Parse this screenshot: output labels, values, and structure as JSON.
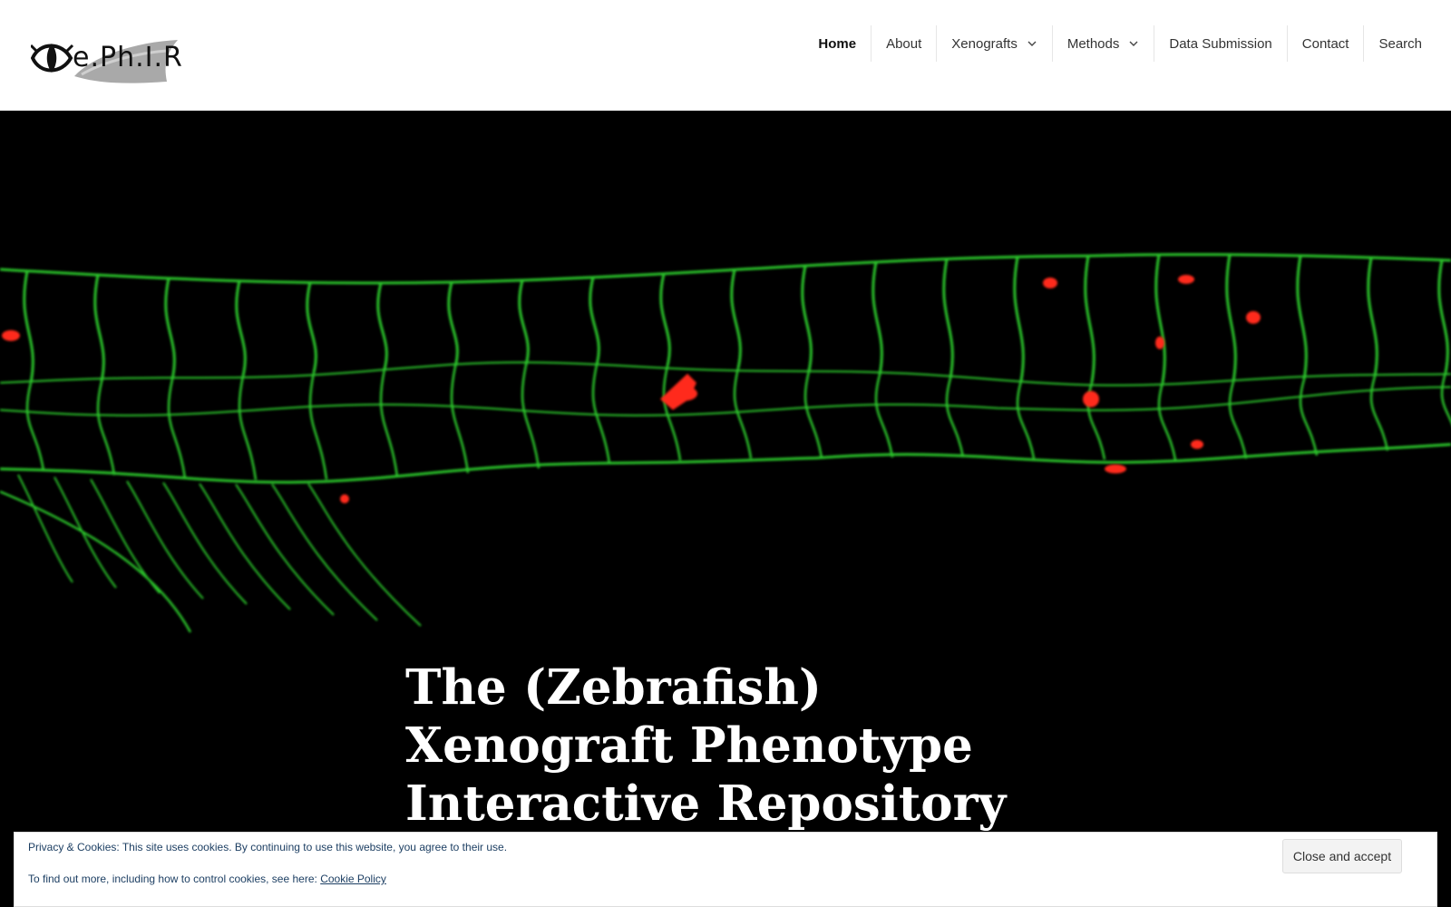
{
  "site": {
    "logo_text": "e.Ph.I.R",
    "logo_icon": "eye-fish-icon"
  },
  "nav": {
    "items": [
      {
        "label": "Home",
        "active": true,
        "has_submenu": false
      },
      {
        "label": "About",
        "active": false,
        "has_submenu": false
      },
      {
        "label": "Xenografts",
        "active": false,
        "has_submenu": true
      },
      {
        "label": "Methods",
        "active": false,
        "has_submenu": true
      },
      {
        "label": "Data Submission",
        "active": false,
        "has_submenu": false
      },
      {
        "label": "Contact",
        "active": false,
        "has_submenu": false
      },
      {
        "label": "Search",
        "active": false,
        "has_submenu": false
      }
    ]
  },
  "hero": {
    "title": "The (Zebrafish) Xenograft Phenotype Interactive Repository",
    "image_colors": {
      "background": "#000000",
      "vessels": "#2fd12f",
      "cells": "#ff2a1a"
    }
  },
  "cookie": {
    "line1": "Privacy & Cookies: This site uses cookies. By continuing to use this website, you agree to their use.",
    "line2_prefix": "To find out more, including how to control cookies, see here:",
    "link_label": "Cookie Policy",
    "button_label": "Close and accept"
  }
}
